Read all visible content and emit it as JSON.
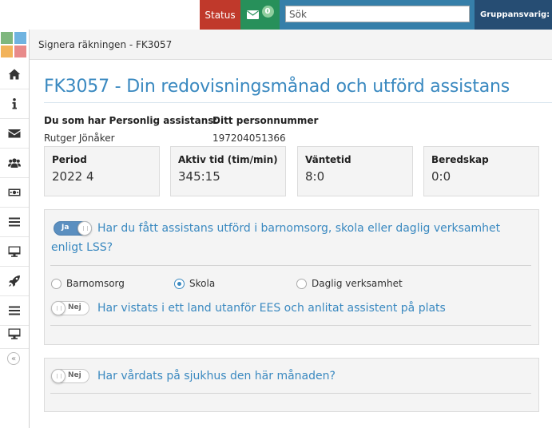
{
  "topbar": {
    "status_label": "Status",
    "mail_count": "0",
    "search_placeholder": "Sök",
    "role_label": "Gruppansvarig: Vis"
  },
  "breadcrumb": "Signera räkningen - FK3057",
  "page_title": "FK3057 - Din redovisningsmånad och utförd assistans",
  "assistant": {
    "label": "Du som har Personlig assistans:",
    "name": "Rutger Jönåker"
  },
  "personnummer": {
    "label": "Ditt personnummer",
    "value": "197204051366"
  },
  "stats": [
    {
      "label": "Period",
      "value": "2022 4"
    },
    {
      "label": "Aktiv tid (tim/min)",
      "value": "345:15"
    },
    {
      "label": "Väntetid",
      "value": "8:0"
    },
    {
      "label": "Beredskap",
      "value": "0:0"
    }
  ],
  "questions": {
    "q1": {
      "toggle_label": "Ja",
      "toggle_on": true,
      "text": "Har du fått assistans utförd i barnomsorg, skola eller daglig verksamhet enligt LSS?",
      "options": [
        {
          "label": "Barnomsorg",
          "checked": false
        },
        {
          "label": "Skola",
          "checked": true
        },
        {
          "label": "Daglig verksamhet",
          "checked": false
        }
      ]
    },
    "q2": {
      "toggle_label": "Nej",
      "toggle_on": false,
      "text": "Har vistats i ett land utanför EES och anlitat assistent på plats"
    },
    "q3": {
      "toggle_label": "Nej",
      "toggle_on": false,
      "text": "Har vårdats på sjukhus den här månaden?"
    }
  },
  "sidebar": {
    "icons": [
      "home-icon",
      "info-icon",
      "envelope-icon",
      "users-icon",
      "money-icon",
      "menu-icon",
      "monitor-icon",
      "rocket-icon",
      "menu-icon",
      "monitor-icon"
    ],
    "collapse_icon": "double-chevron-left-icon"
  },
  "colors": {
    "accent": "#3a89c0",
    "status": "#c0392b",
    "mail": "#27905a",
    "topbar": "#367fa9"
  }
}
